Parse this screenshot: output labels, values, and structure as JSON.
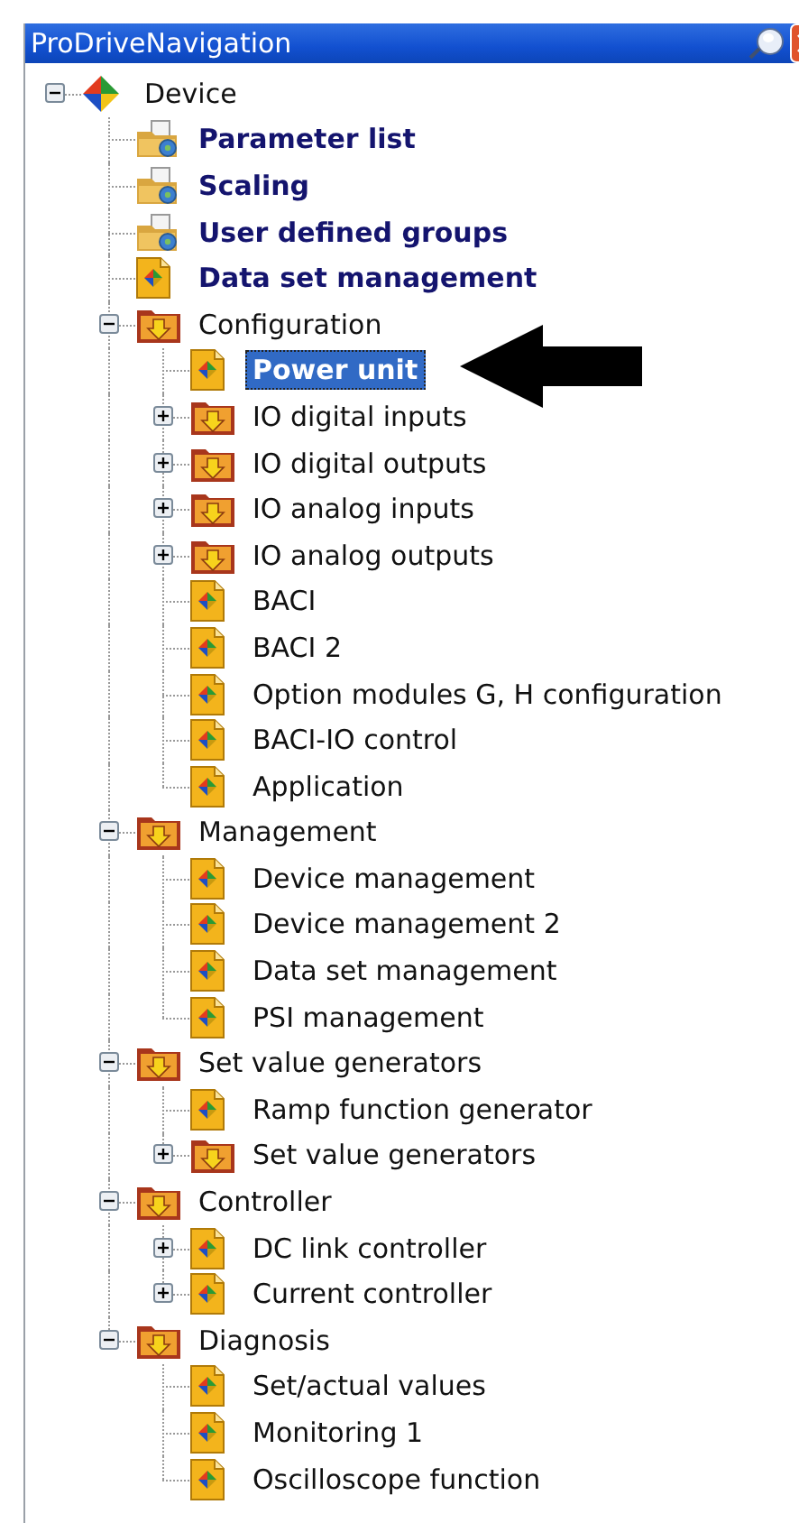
{
  "window": {
    "title": "ProDriveNavigation"
  },
  "tree": [
    {
      "label": "Device",
      "kind": "device",
      "bold": false,
      "selected": false,
      "expanded": true,
      "children": [
        {
          "label": "Parameter list",
          "kind": "tool-folder",
          "bold": true,
          "selected": false
        },
        {
          "label": "Scaling",
          "kind": "tool-folder",
          "bold": true,
          "selected": false
        },
        {
          "label": "User defined groups",
          "kind": "tool-folder",
          "bold": true,
          "selected": false
        },
        {
          "label": "Data set management",
          "kind": "document",
          "bold": true,
          "selected": false
        },
        {
          "label": "Configuration",
          "kind": "folder",
          "bold": false,
          "selected": false,
          "expanded": true,
          "children": [
            {
              "label": "Power unit",
              "kind": "document",
              "bold": true,
              "selected": true
            },
            {
              "label": "IO digital inputs",
              "kind": "folder",
              "bold": false,
              "selected": false,
              "expanded": false
            },
            {
              "label": "IO digital outputs",
              "kind": "folder",
              "bold": false,
              "selected": false,
              "expanded": false
            },
            {
              "label": "IO analog inputs",
              "kind": "folder",
              "bold": false,
              "selected": false,
              "expanded": false
            },
            {
              "label": "IO analog outputs",
              "kind": "folder",
              "bold": false,
              "selected": false,
              "expanded": false
            },
            {
              "label": "BACI",
              "kind": "document",
              "bold": false,
              "selected": false
            },
            {
              "label": "BACI 2",
              "kind": "document",
              "bold": false,
              "selected": false
            },
            {
              "label": "Option modules G, H configuration",
              "kind": "document",
              "bold": false,
              "selected": false
            },
            {
              "label": "BACI-IO control",
              "kind": "document",
              "bold": false,
              "selected": false
            },
            {
              "label": "Application",
              "kind": "document",
              "bold": false,
              "selected": false
            }
          ]
        },
        {
          "label": "Management",
          "kind": "folder",
          "bold": false,
          "selected": false,
          "expanded": true,
          "children": [
            {
              "label": "Device management",
              "kind": "document",
              "bold": false,
              "selected": false
            },
            {
              "label": "Device management 2",
              "kind": "document",
              "bold": false,
              "selected": false
            },
            {
              "label": "Data set management",
              "kind": "document",
              "bold": false,
              "selected": false
            },
            {
              "label": "PSI management",
              "kind": "document",
              "bold": false,
              "selected": false
            }
          ]
        },
        {
          "label": "Set value generators",
          "kind": "folder",
          "bold": false,
          "selected": false,
          "expanded": true,
          "children": [
            {
              "label": "Ramp function generator",
              "kind": "document",
              "bold": false,
              "selected": false
            },
            {
              "label": "Set value generators",
              "kind": "folder",
              "bold": false,
              "selected": false,
              "expanded": false
            }
          ]
        },
        {
          "label": "Controller",
          "kind": "folder",
          "bold": false,
          "selected": false,
          "expanded": true,
          "children": [
            {
              "label": "DC link controller",
              "kind": "document",
              "bold": false,
              "selected": false,
              "expanded": false
            },
            {
              "label": "Current controller",
              "kind": "document",
              "bold": false,
              "selected": false,
              "expanded": false
            }
          ]
        },
        {
          "label": "Diagnosis",
          "kind": "folder",
          "bold": false,
          "selected": false,
          "expanded": true,
          "children": [
            {
              "label": "Set/actual values",
              "kind": "document",
              "bold": false,
              "selected": false
            },
            {
              "label": "Monitoring 1",
              "kind": "document",
              "bold": false,
              "selected": false
            },
            {
              "label": "Oscilloscope function",
              "kind": "document",
              "bold": false,
              "selected": false
            }
          ]
        }
      ]
    }
  ]
}
